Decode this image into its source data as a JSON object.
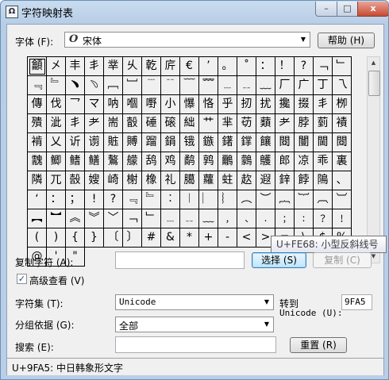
{
  "window": {
    "title": "字符映射表",
    "app_icon": "charmap-icon",
    "minimize_glyph": "–",
    "maximize_glyph": "□",
    "close_glyph": "x"
  },
  "font_row": {
    "label": "字体 (F):",
    "font_glyph": "O",
    "font_value": "宋体",
    "help_button": "帮助 (H)"
  },
  "grid": {
    "rows": [
      [
        "龥",
        "㐅",
        "丰",
        "丯",
        "丵",
        "乆",
        "亁",
        "庍",
        "€",
        "’",
        "。",
        "˚",
        "：",
        "！",
        "?",
        "﹁",
        "﹂"
      ],
      [
        "﹃",
        "﹄",
        "﹅",
        "﹆",
        "﹇",
        "﹈",
        "﹉",
        "﹊",
        "﹋",
        "﹌",
        "﹍",
        "﹎",
        "﹏",
        "厂",
        "广",
        "丁",
        "乁"
      ],
      [
        "傳",
        "伐",
        "乛",
        "マ",
        "呐",
        "嗰",
        "嘢",
        "小",
        "懪",
        "恪",
        "乎",
        "扨",
        "扰",
        "攙",
        "掇",
        "丯",
        "栁"
      ],
      [
        "殨",
        "泚",
        "丯",
        "耂",
        "耑",
        "瞉",
        "硾",
        "磙",
        "絀",
        "艹",
        "芈",
        "苆",
        "蘱",
        "耂",
        "脖",
        "菿",
        "襀"
      ],
      [
        "褃",
        "乂",
        "䜣",
        "谫",
        "賘",
        "賻",
        "蹓",
        "鋗",
        "锇",
        "鏃",
        "鐯",
        "鐣",
        "饟",
        "閸",
        "闦",
        "閫",
        "閸"
      ],
      [
        "䰰",
        "鲫",
        "鳍",
        "鳝",
        "鷔",
        "艨",
        "鸹",
        "鸡",
        "鹬",
        "鹑",
        "鸍",
        "鸏",
        "鸌",
        "郎",
        "凉",
        "乖",
        "裏"
      ],
      [
        "隣",
        "兀",
        "嗀",
        "嫂",
        "崎",
        "榭",
        "橡",
        "礼",
        "臈",
        "蘿",
        "蛀",
        "赼",
        "遐",
        "鋅",
        "餑",
        "隝",
        "、"
      ],
      [
        "‘",
        "：",
        "；",
        "!",
        "?",
        "﹃",
        "﹄",
        "︰",
        "︱",
        "︳",
        "︴",
        "︵",
        "︶",
        "︷",
        "︸",
        "︹",
        "︺"
      ],
      [
        "︻",
        "︼",
        "︽",
        "︾",
        "﹀",
        "﹁",
        "﹂",
        "﹍",
        "﹎",
        "﹏",
        "﹐",
        "﹑",
        "﹒",
        "﹔",
        "﹕",
        "﹖",
        "﹗"
      ],
      [
        "(",
        ")",
        "{",
        "}",
        "〔",
        "〕",
        "#",
        "&",
        "*",
        "+",
        "-",
        "<",
        ">",
        "=",
        "\\",
        "$",
        "%"
      ],
      [
        "@",
        "'",
        "\""
      ]
    ],
    "row0_note": "",
    "selected_char": "龥"
  },
  "tooltip": {
    "text": "U+FE68: 小型反斜线号"
  },
  "copy_row": {
    "label": "复制字符 (A):",
    "value": "",
    "select_button": "选择 (S)",
    "copy_button": "复制 (C)"
  },
  "advanced": {
    "label": "高级查看 (V)",
    "checked": true,
    "check_glyph": "✓"
  },
  "charset": {
    "label": "字符集 (T):",
    "value": "Unicode",
    "goto_label_1": "转到",
    "goto_label_2": "Unicode (U):",
    "goto_value": "9FA5"
  },
  "groupby": {
    "label": "分组依据 (G):",
    "value": "全部"
  },
  "search": {
    "label": "搜索 (E):",
    "value": "",
    "reset_button": "重置 (R)"
  },
  "status": {
    "text": "U+9FA5: 中日韩象形文字"
  },
  "scrollbar": {
    "up": "▲",
    "down": "▼"
  },
  "colors": {
    "title_bg": "#bcd2ea",
    "close": "#c74b33",
    "client": "#f0f0f0"
  }
}
